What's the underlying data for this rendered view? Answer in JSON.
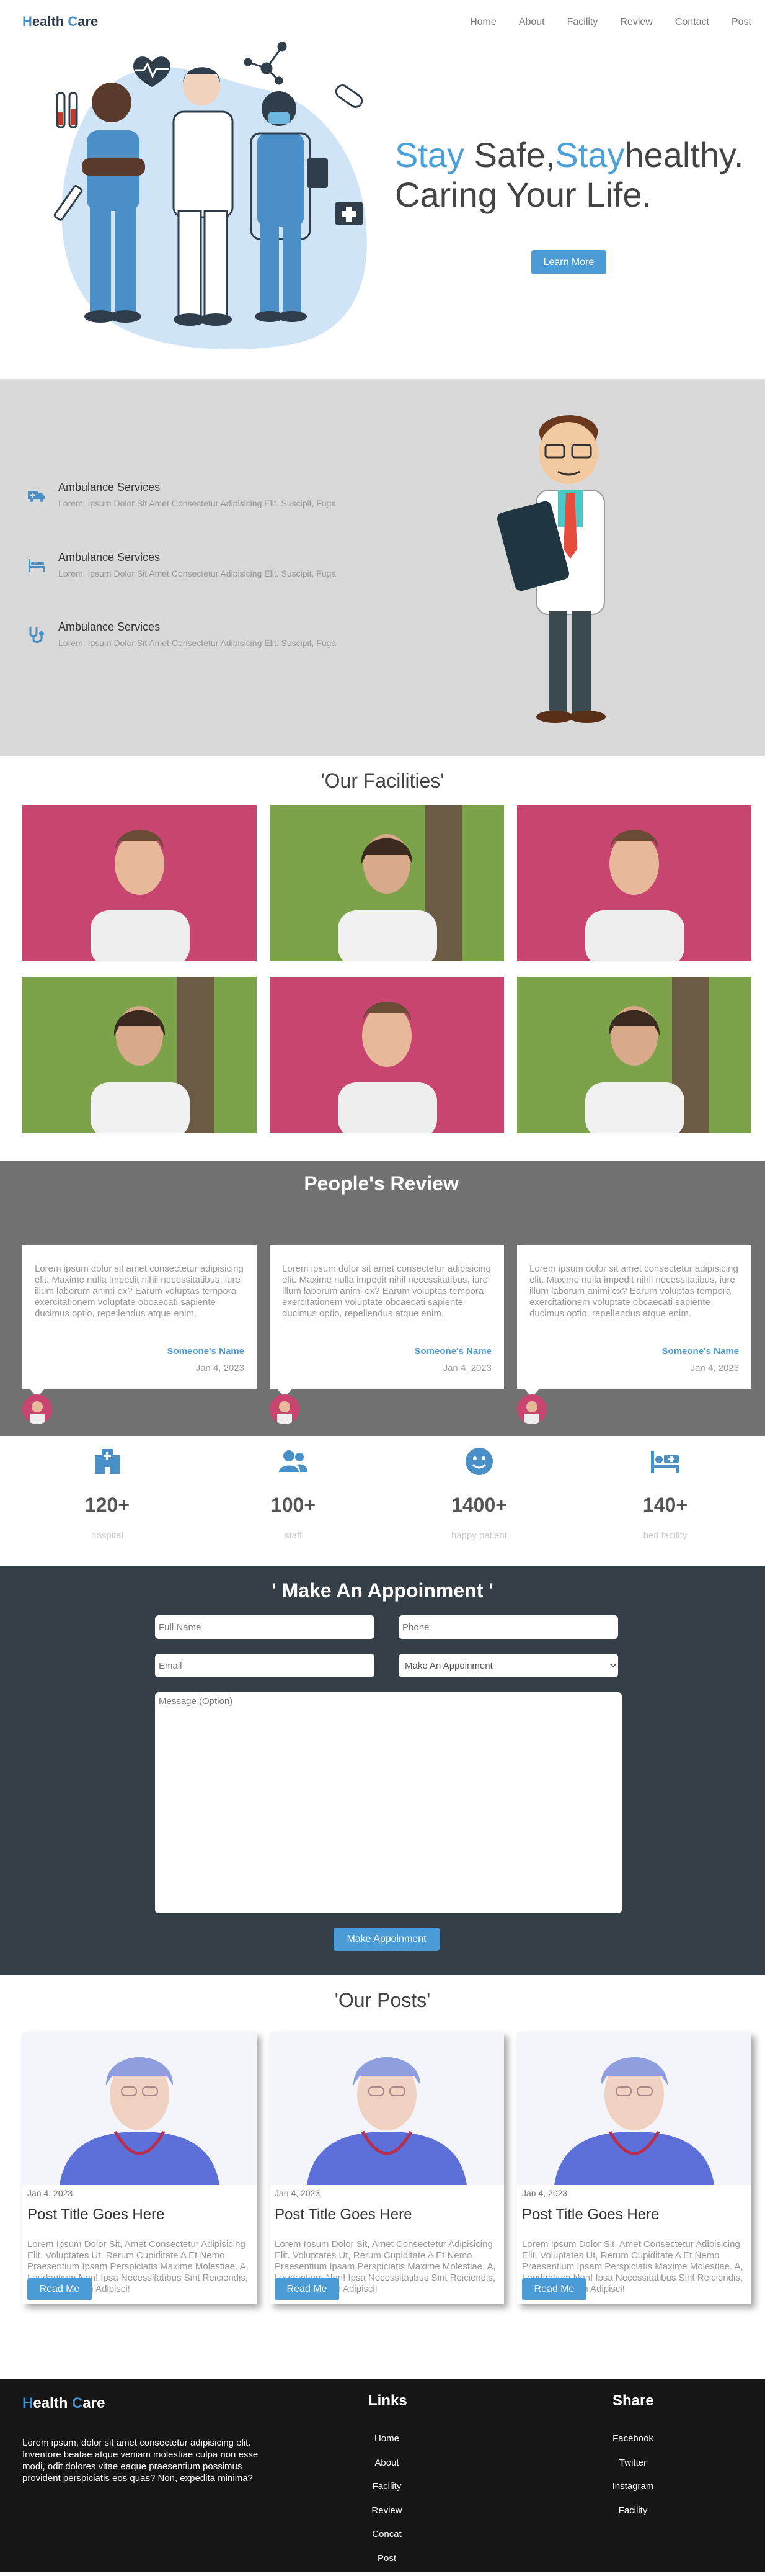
{
  "brand": {
    "first_letter": "H",
    "rest_a": "ealth ",
    "c_letter": "C",
    "rest_b": "are"
  },
  "nav": [
    "Home",
    "About",
    "Facility",
    "Review",
    "Contact",
    "Post"
  ],
  "hero": {
    "w1": "Stay",
    "w2": " Safe,",
    "w3": "Stay",
    "w4": "healthy.",
    "line2": "Caring Your Life.",
    "button": "Learn More"
  },
  "services": [
    {
      "title": "Ambulance Services",
      "desc": "Lorem, Ipsum Dolor Sit Amet Consectetur Adipisicing Elit. Suscipit, Fuga",
      "icon": "truck-icon"
    },
    {
      "title": "Ambulance Services",
      "desc": "Lorem, Ipsum Dolor Sit Amet Consectetur Adipisicing Elit. Suscipit, Fuga",
      "icon": "bed-icon"
    },
    {
      "title": "Ambulance Services",
      "desc": "Lorem, Ipsum Dolor Sit Amet Consectetur Adipisicing Elit. Suscipit, Fuga",
      "icon": "stethoscope-icon"
    }
  ],
  "facilities": {
    "title": "'Our Facilities'"
  },
  "reviews": {
    "title": "People's Review",
    "title_mark": "'",
    "items": [
      {
        "text": "Lorem ipsum dolor sit amet consectetur adipisicing elit. Maxime nulla impedit nihil necessitatibus, iure illum laborum animi ex? Earum voluptas tempora exercitationem voluptate obcaecati sapiente ducimus optio, repellendus atque enim.",
        "name": "Someone's Name",
        "date": "Jan 4, 2023"
      },
      {
        "text": "Lorem ipsum dolor sit amet consectetur adipisicing elit. Maxime nulla impedit nihil necessitatibus, iure illum laborum animi ex? Earum voluptas tempora exercitationem voluptate obcaecati sapiente ducimus optio, repellendus atque enim.",
        "name": "Someone's Name",
        "date": "Jan 4, 2023"
      },
      {
        "text": "Lorem ipsum dolor sit amet consectetur adipisicing elit. Maxime nulla impedit nihil necessitatibus, iure illum laborum animi ex? Earum voluptas tempora exercitationem voluptate obcaecati sapiente ducimus optio, repellendus atque enim.",
        "name": "Someone's Name",
        "date": "Jan 4, 2023"
      }
    ]
  },
  "stats": [
    {
      "num": "120+",
      "label": "hospital",
      "icon": "hospital-icon"
    },
    {
      "num": "100+",
      "label": "staff",
      "icon": "users-icon"
    },
    {
      "num": "1400+",
      "label": "happy patient",
      "icon": "smile-icon"
    },
    {
      "num": "140+",
      "label": "bed facility",
      "icon": "bed-icon"
    }
  ],
  "appointment": {
    "title": "' Make An Appoinment '",
    "full_name": "Full Name",
    "phone": "Phone",
    "email": "Email",
    "select": "Make An Appoinment",
    "message": "Message (Option)",
    "button": "Make Appoinment"
  },
  "posts": {
    "title": "'Our Posts'",
    "items": [
      {
        "date": "Jan 4, 2023",
        "title": "Post Title Goes Here",
        "body": "Lorem Ipsum Dolor Sit, Amet Consectetur Adipisicing Elit. Voluptates Ut, Rerum Cupiditate A Et Nemo Praesentium Ipsam Perspiciatis Maxime Molestiae. A, Laudantium Non! Ipsa Necessitatibus Sint Reiciendis, Veniam Quidem Adipisci!",
        "button": "Read Me"
      },
      {
        "date": "Jan 4, 2023",
        "title": "Post Title Goes Here",
        "body": "Lorem Ipsum Dolor Sit, Amet Consectetur Adipisicing Elit. Voluptates Ut, Rerum Cupiditate A Et Nemo Praesentium Ipsam Perspiciatis Maxime Molestiae. A, Laudantium Non! Ipsa Necessitatibus Sint Reiciendis, Veniam Quidem Adipisci!",
        "button": "Read Me"
      },
      {
        "date": "Jan 4, 2023",
        "title": "Post Title Goes Here",
        "body": "Lorem Ipsum Dolor Sit, Amet Consectetur Adipisicing Elit. Voluptates Ut, Rerum Cupiditate A Et Nemo Praesentium Ipsam Perspiciatis Maxime Molestiae. A, Laudantium Non! Ipsa Necessitatibus Sint Reiciendis, Veniam Quidem Adipisci!",
        "button": "Read Me"
      }
    ]
  },
  "footer": {
    "desc": "Lorem ipsum, dolor sit amet consectetur adipisicing elit. Inventore beatae atque veniam molestiae culpa non esse modi, odit dolores vitae eaque praesentium possimus provident perspiciatis eos quas? Non, expedita minima?",
    "links_title": "Links",
    "links": [
      "Home",
      "About",
      "Facility",
      "Review",
      "Concat",
      "Post"
    ],
    "share_title": "Share",
    "share": [
      "Facebook",
      "Twitter",
      "Instagram",
      "Facility"
    ]
  },
  "colors": {
    "accent": "#4a9bd6",
    "services_bg": "#d9d9d9",
    "reviews_bg": "#717171",
    "appointment_bg": "#343f48",
    "footer_bg": "#161616"
  }
}
